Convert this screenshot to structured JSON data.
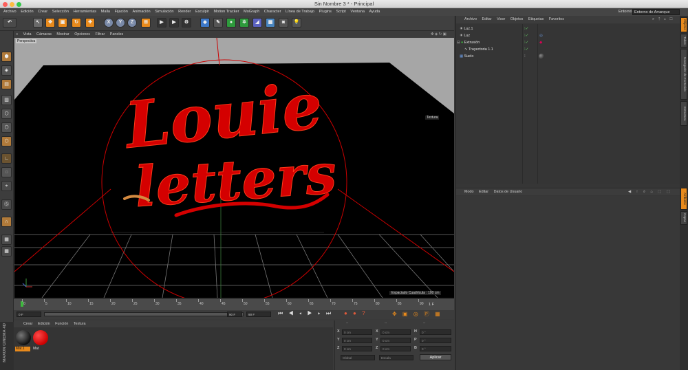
{
  "window": {
    "title": "Sin Nombre 3 * - Principal"
  },
  "menu": [
    "Archivo",
    "Edición",
    "Crear",
    "Selección",
    "Herramientas",
    "Malla",
    "Fijación",
    "Animación",
    "Simulación",
    "Render",
    "Esculpir",
    "Motion Tracker",
    "MoGraph",
    "Character",
    "Línea de Trabajo",
    "Plugins",
    "Script",
    "Ventana",
    "Ayuda"
  ],
  "environment": {
    "label": "Entorno:",
    "value": "Entorno de Arranque"
  },
  "toolbar": {
    "axis_x": "X",
    "axis_y": "Y",
    "axis_z": "Z"
  },
  "viewport": {
    "menu": [
      "Vista",
      "Cámaras",
      "Mostrar",
      "Opciones",
      "Filtrar",
      "Paneles"
    ],
    "camera_label": "Perspectiva",
    "texture_label": "Textura",
    "grid_spacing": "Espaciado Cuadrícula : 100 cm",
    "artwork_line1": "Louie",
    "artwork_line2": "letters"
  },
  "timeline": {
    "ticks": [
      "0",
      "5",
      "10",
      "15",
      "20",
      "25",
      "30",
      "35",
      "40",
      "45",
      "50",
      "55",
      "60",
      "65",
      "70",
      "75",
      "80",
      "85",
      "90"
    ],
    "current_frame": "1 F",
    "start_field": "0 F",
    "end_field": "90 F",
    "min_field": "0 F",
    "max_field": "90 F"
  },
  "materials": {
    "menu": [
      "Crear",
      "Edición",
      "Función",
      "Textura"
    ],
    "items": [
      {
        "name": "Mat.1"
      },
      {
        "name": "Mat"
      }
    ]
  },
  "maxon_logo": "MAXON CINEMA 4D",
  "coords": {
    "header": [
      "--",
      "--",
      "--"
    ],
    "rows": [
      {
        "a": "X",
        "av": "0 cm",
        "b": "X",
        "bv": "0 cm",
        "c": "H",
        "cv": "0 °"
      },
      {
        "a": "Y",
        "av": "0 cm",
        "b": "Y",
        "bv": "0 cm",
        "c": "P",
        "cv": "0 °"
      },
      {
        "a": "Z",
        "av": "0 cm",
        "b": "Z",
        "bv": "0 cm",
        "c": "B",
        "cv": "0 °"
      }
    ],
    "mode1": "Global",
    "mode2": "Escala",
    "apply": "Aplicar"
  },
  "objects_manager": {
    "menu": [
      "Archivo",
      "Editar",
      "Visor",
      "Objetos",
      "Etiquetas",
      "Favoritos"
    ],
    "items": [
      {
        "name": "Luz.1"
      },
      {
        "name": "Luz"
      },
      {
        "name": "Extrusión"
      },
      {
        "name": "Trayectoria 1.1"
      },
      {
        "name": "Suelo"
      }
    ]
  },
  "attributes_manager": {
    "menu": [
      "Modo",
      "Editar",
      "Datos de Usuario"
    ]
  },
  "side_tabs_top": [
    "Objetos",
    "Takes",
    "Navegador de Contenido",
    "Estructura"
  ],
  "side_tabs_bottom": [
    "Atributos",
    "Capas"
  ],
  "colors": {
    "accent": "#e88a1c",
    "artwork": "#d40000",
    "background": "#3a3a3a"
  }
}
